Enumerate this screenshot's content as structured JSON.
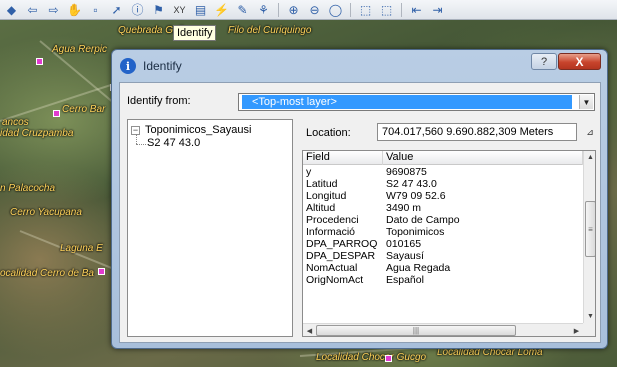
{
  "map": {
    "labels": [
      "Quebrada Galle",
      "Filo del Curiquingo",
      "Agua Rerpic",
      "Cerro Bar",
      "ancos",
      "idad Cruzpamba",
      "n Palacocha",
      "Cerro Yacupana",
      "Laguna E",
      "ocalidad Cerro de Ba",
      "Localidad Chocar Gucgo",
      "Localidad Chocar Loma"
    ]
  },
  "toolbar": {
    "icons": [
      "identify-icon",
      "back-icon",
      "forward-icon",
      "pan-icon",
      "select-icon",
      "info-icon",
      "find-icon",
      "xy-icon",
      "measure-icon",
      "hyperlink-icon",
      "zoom-in-icon",
      "zoom-out-icon",
      "full-extent-icon",
      "fixed-zoom-icon"
    ],
    "xy_label": "XY",
    "tooltip": "Identify"
  },
  "dialog": {
    "title": "Identify",
    "help_label": "?",
    "close_label": "X",
    "identify_from_label": "Identify from:",
    "identify_from_value": "<Top-most layer>",
    "tree": {
      "root_label": "Toponimicos_Sayausi",
      "child_label": "S2 47 43.0"
    },
    "location_label": "Location:",
    "location_value": "704.017,560  9.690.882,309 Meters",
    "columns": {
      "field": "Field",
      "value": "Value"
    },
    "rows": [
      {
        "field": "y",
        "value": "9690875"
      },
      {
        "field": "Latitud",
        "value": "S2 47 43.0"
      },
      {
        "field": "Longitud",
        "value": "W79 09 52.6"
      },
      {
        "field": "Altitud",
        "value": "3490 m"
      },
      {
        "field": "Procedenci",
        "value": "Dato de Campo"
      },
      {
        "field": "Informació",
        "value": "Toponimicos"
      },
      {
        "field": "DPA_PARROQ",
        "value": "010165"
      },
      {
        "field": "DPA_DESPAR",
        "value": "Sayausí"
      },
      {
        "field": "NomActual",
        "value": "Agua Regada"
      },
      {
        "field": "OrigNomAct",
        "value": "Español"
      }
    ]
  }
}
